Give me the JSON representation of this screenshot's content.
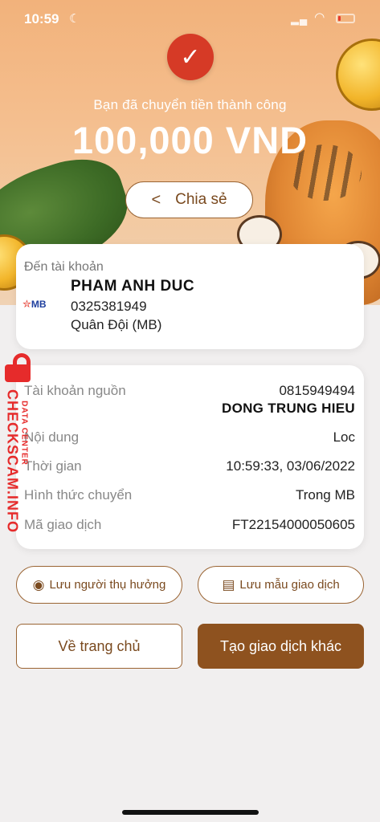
{
  "status_bar": {
    "time": "10:59",
    "moon_icon": "moon-icon",
    "wifi_icon": "wifi-icon",
    "battery_icon": "battery-low-icon",
    "battery_color": "#e53a2e"
  },
  "header": {
    "check_icon": "checkmark-icon",
    "success_message": "Bạn đã chuyển tiền thành công",
    "amount": "100,000 VND",
    "share_label": "Chia sẻ",
    "share_icon": "share-icon"
  },
  "destination": {
    "label": "Đến tài khoản",
    "bank_logo_text": "MB",
    "name": "PHAM ANH DUC",
    "account_number": "0325381949",
    "bank_name": "Quân Đội (MB)"
  },
  "details": {
    "source_account_label": "Tài khoản nguồn",
    "source_account_number": "0815949494",
    "source_account_name": "DONG TRUNG HIEU",
    "content_label": "Nội dung",
    "content_value": "Loc",
    "time_label": "Thời gian",
    "time_value": "10:59:33, 03/06/2022",
    "method_label": "Hình thức chuyển",
    "method_value": "Trong MB",
    "transaction_label": "Mã giao dịch",
    "transaction_value": "FT22154000050605"
  },
  "actions": {
    "save_recipient": "Lưu người thụ hưởng",
    "save_template": "Lưu mẫu giao dịch",
    "home": "Về trang chủ",
    "new_transaction": "Tạo giao dịch khác"
  },
  "watermark": {
    "brand": "CHECKSCAM.INFO",
    "sub": "DATA CENTER"
  },
  "colors": {
    "accent_brown": "#8e521f",
    "success_red": "#d63a26",
    "watermark_red": "#e62b2b"
  }
}
